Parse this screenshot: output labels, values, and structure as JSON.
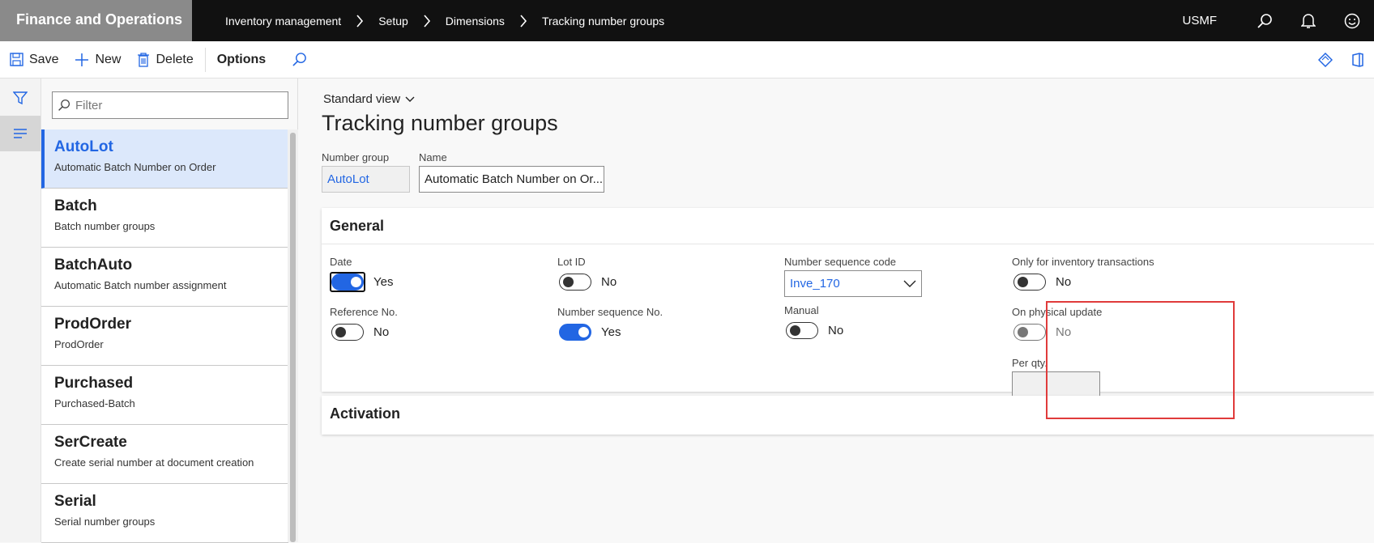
{
  "app": {
    "title": "Finance and Operations",
    "company": "USMF"
  },
  "breadcrumb": [
    "Inventory management",
    "Setup",
    "Dimensions",
    "Tracking number groups"
  ],
  "actions": {
    "save": "Save",
    "new": "New",
    "delete": "Delete",
    "options": "Options"
  },
  "filter": {
    "placeholder": "Filter"
  },
  "list": [
    {
      "title": "AutoLot",
      "desc": "Automatic Batch Number on Order"
    },
    {
      "title": "Batch",
      "desc": "Batch number groups"
    },
    {
      "title": "BatchAuto",
      "desc": "Automatic Batch number assignment"
    },
    {
      "title": "ProdOrder",
      "desc": "ProdOrder"
    },
    {
      "title": "Purchased",
      "desc": "Purchased-Batch"
    },
    {
      "title": "SerCreate",
      "desc": "Create serial number at document creation"
    },
    {
      "title": "Serial",
      "desc": "Serial number groups"
    }
  ],
  "main": {
    "view": "Standard view",
    "title": "Tracking number groups",
    "number_group_label": "Number group",
    "number_group_value": "AutoLot",
    "name_label": "Name",
    "name_value": "Automatic Batch Number on Or..."
  },
  "general": {
    "title": "General",
    "date": {
      "label": "Date",
      "value": "Yes"
    },
    "reference_no": {
      "label": "Reference No.",
      "value": "No"
    },
    "lot_id": {
      "label": "Lot ID",
      "value": "No"
    },
    "number_sequence_no": {
      "label": "Number sequence No.",
      "value": "Yes"
    },
    "number_sequence_code": {
      "label": "Number sequence code",
      "value": "Inve_170"
    },
    "manual": {
      "label": "Manual",
      "value": "No"
    },
    "only_inventory": {
      "label": "Only for inventory transactions",
      "value": "No"
    },
    "on_physical_update": {
      "label": "On physical update",
      "value": "No"
    },
    "per_qty": {
      "label": "Per qty."
    }
  },
  "activation": {
    "title": "Activation"
  },
  "colors": {
    "accent": "#2266e3",
    "highlight": "#e03b3b"
  }
}
